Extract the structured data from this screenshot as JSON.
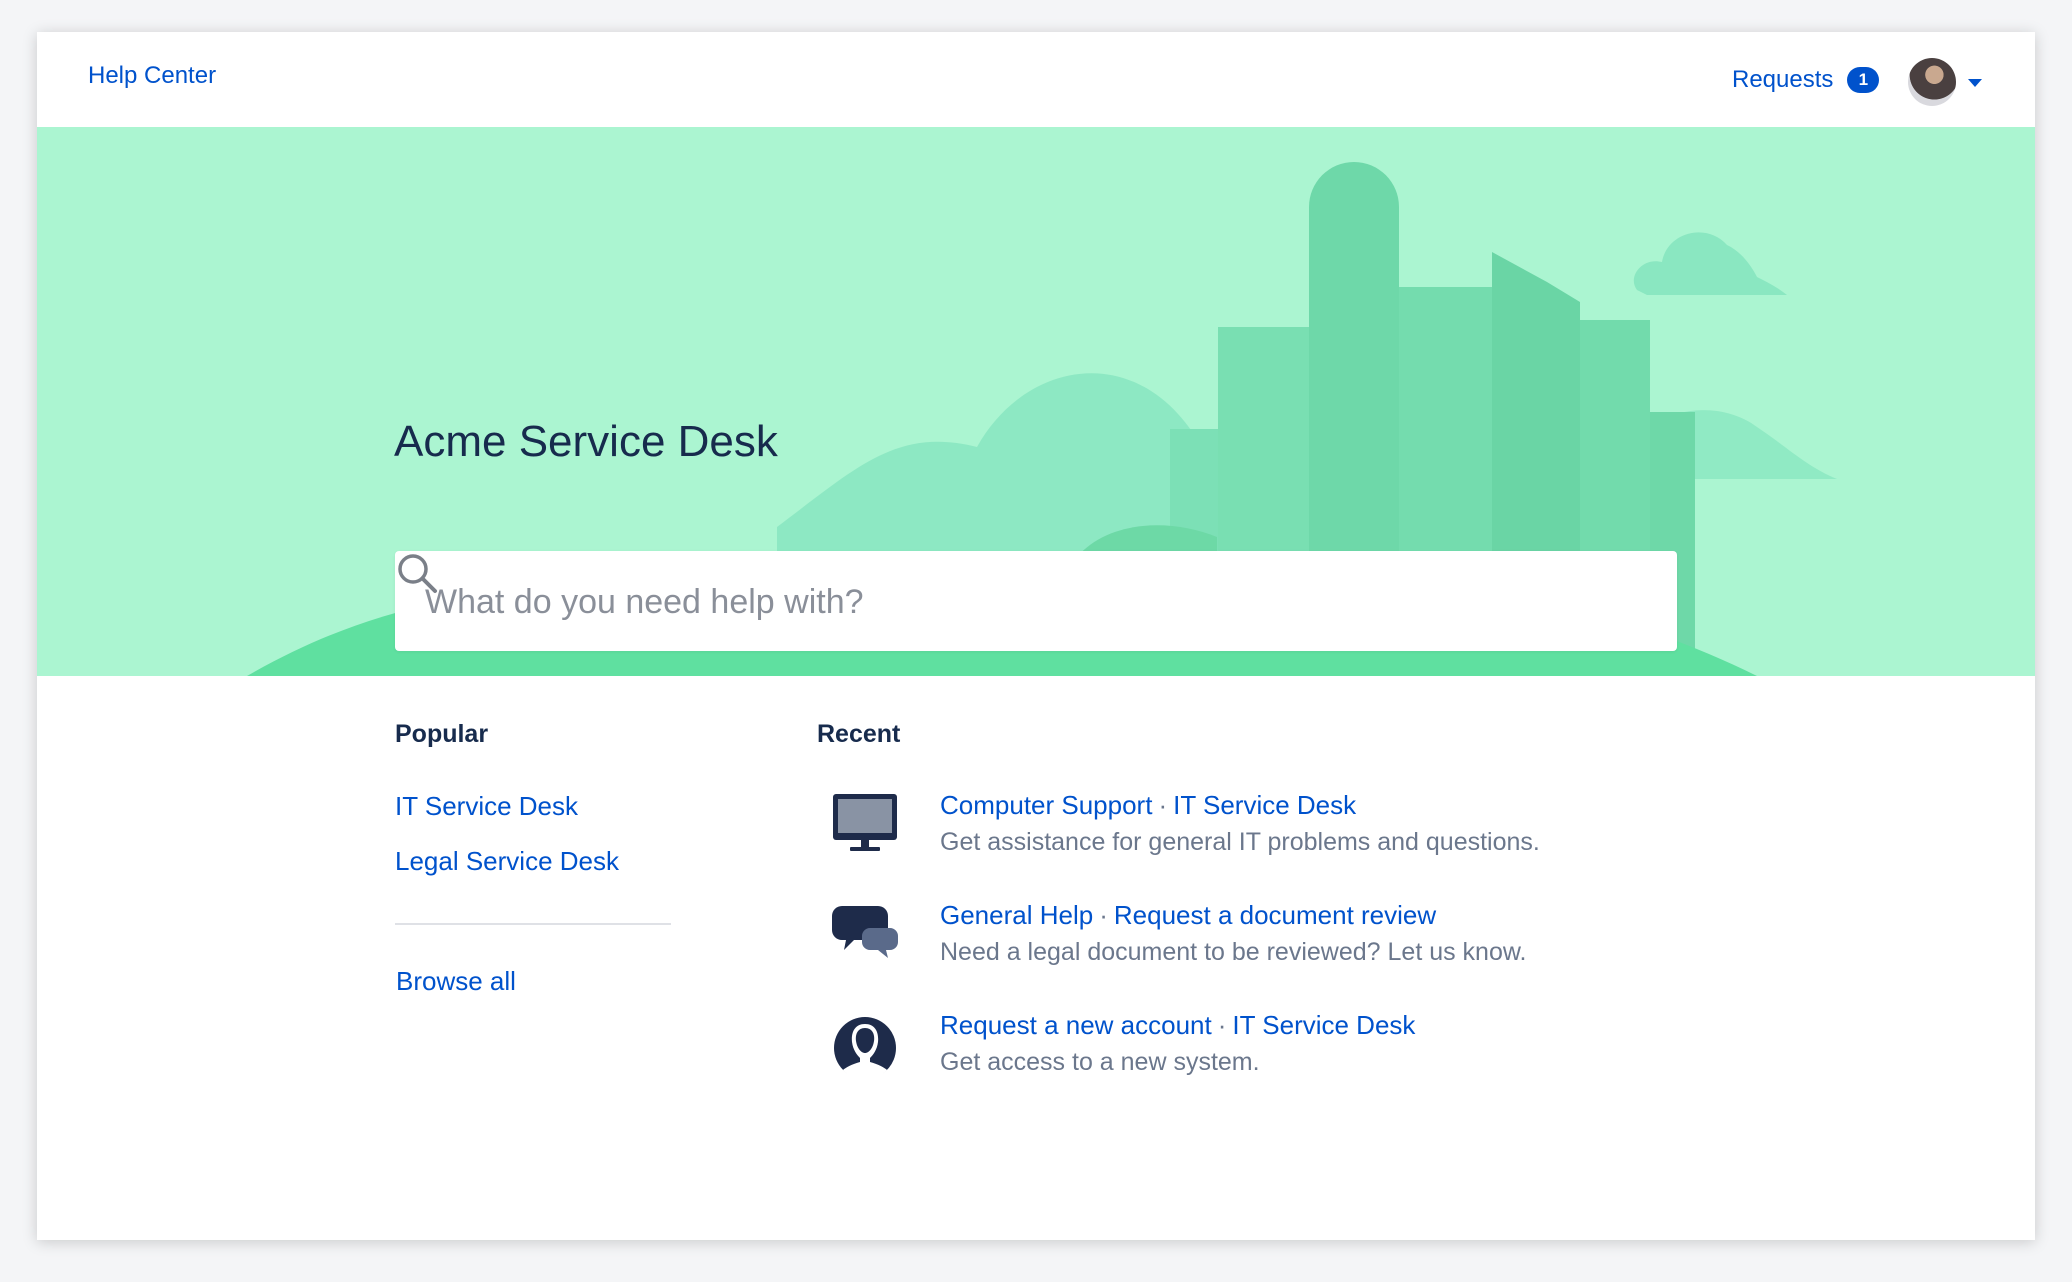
{
  "header": {
    "help_center": "Help Center",
    "requests_label": "Requests",
    "requests_count": "1"
  },
  "hero": {
    "title": "Acme Service Desk",
    "search_placeholder": "What do you need help with?",
    "background_color": "#abf5d1"
  },
  "popular": {
    "heading": "Popular",
    "links": [
      "IT Service Desk",
      "Legal Service Desk"
    ],
    "browse_all": "Browse all"
  },
  "recent": {
    "heading": "Recent",
    "items": [
      {
        "icon": "monitor-icon",
        "primary": "Computer Support",
        "secondary": "IT Service Desk",
        "description": "Get assistance for general IT problems and questions."
      },
      {
        "icon": "chat-bubbles-icon",
        "primary": "General Help",
        "secondary": "Request a document review",
        "description": "Need a legal document to be reviewed? Let us know."
      },
      {
        "icon": "user-account-icon",
        "primary": "Request a new account",
        "secondary": "IT Service Desk",
        "description": "Get access to a new system."
      }
    ]
  },
  "colors": {
    "link": "#0052cc",
    "heading": "#172b4d",
    "muted": "#6b778c"
  }
}
